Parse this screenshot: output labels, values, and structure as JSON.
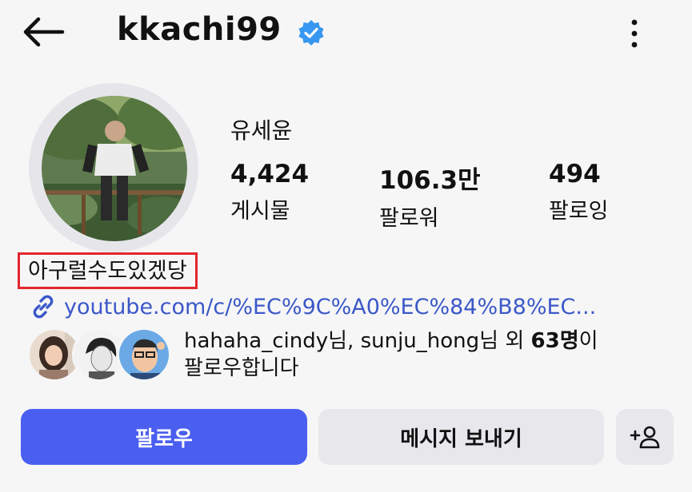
{
  "header": {
    "username": "kkachi99",
    "back_icon": "arrow-left-icon",
    "verified_icon": "verified-badge-icon",
    "verified_color": "#3897f0",
    "more_icon": "more-vertical-icon"
  },
  "profile": {
    "display_name": "유세윤",
    "stats": [
      {
        "value": "4,424",
        "label": "게시물"
      },
      {
        "value": "106.3만",
        "label": "팔로워"
      },
      {
        "value": "494",
        "label": "팔로잉"
      }
    ],
    "bio": "아구럴수도있겠당",
    "link_icon": "link-icon",
    "link": "youtube.com/c/%EC%9C%A0%EC%84%B8%EC..."
  },
  "mutual": {
    "user1": "hahaha_cindy",
    "suffix1": "님, ",
    "user2": "sunju_hong",
    "suffix2": "님 외 ",
    "count": "63명",
    "suffix3": "이",
    "line2": "팔로우합니다"
  },
  "actions": {
    "follow_label": "팔로우",
    "message_label": "메시지 보내기",
    "add_user_icon": "add-user-icon",
    "follow_color": "#4a5ef0"
  }
}
